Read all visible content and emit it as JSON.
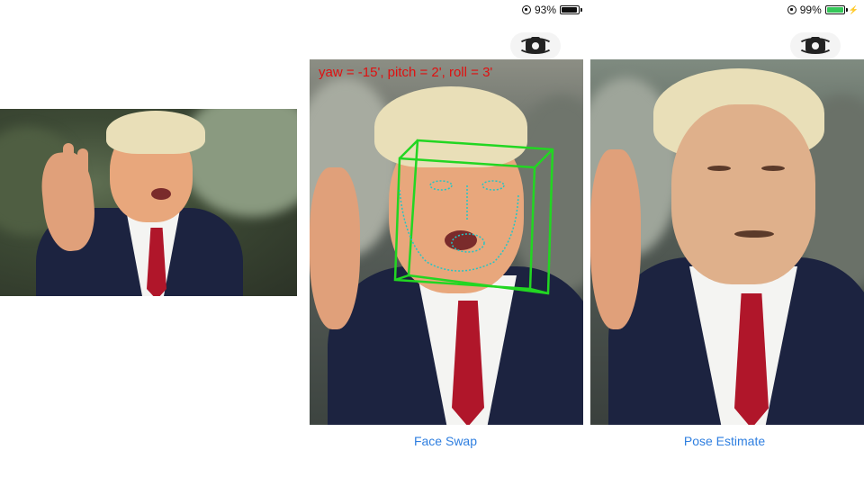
{
  "left_image": {
    "description_label": ""
  },
  "screens": [
    {
      "id": "face",
      "status": {
        "battery": "93%",
        "battery_level": 0.93,
        "charging": false,
        "battery_color": "#111111"
      },
      "pose_readout": "yaw = -15', pitch = 2', roll = 3'",
      "tab_label": "Face Swap",
      "overlay_color": "#22d622",
      "landmark_color": "#22c6c6"
    },
    {
      "id": "pose",
      "status": {
        "battery": "99%",
        "battery_level": 0.99,
        "charging": true,
        "battery_color": "#35c759"
      },
      "tab_label": "Pose Estimate"
    }
  ],
  "icons": {
    "camera_switch": "camera-switch-icon",
    "orientation_lock": "orientation-lock-icon",
    "battery": "battery-icon",
    "charging": "charging-bolt-icon"
  },
  "colors": {
    "link": "#2f7fe0",
    "readout": "#e01010"
  }
}
